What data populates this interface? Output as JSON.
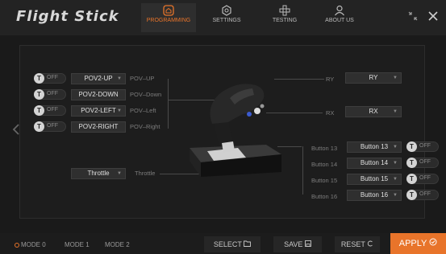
{
  "app": {
    "title": "Flight Stick"
  },
  "nav": {
    "programming": "PROGRAMMING",
    "settings": "SETTINGS",
    "testing": "TESTING",
    "about": "ABOUT US"
  },
  "colors": {
    "accent": "#e8742a",
    "background": "#1a1a1a",
    "panel": "#1d1d1d"
  },
  "left_rows": [
    {
      "toggle": "OFF",
      "button": "POV2-UP",
      "label": "POV–UP"
    },
    {
      "toggle": "OFF",
      "button": "POV2-DOWN",
      "label": "POV–Down"
    },
    {
      "toggle": "OFF",
      "button": "POV2-LEFT",
      "label": "POV–Left"
    },
    {
      "toggle": "OFF",
      "button": "POV2-RIGHT",
      "label": "POV–Right"
    }
  ],
  "throttle": {
    "button": "Throttle",
    "label": "Throttle"
  },
  "axes": [
    {
      "label": "RY",
      "value": "RY"
    },
    {
      "label": "RX",
      "value": "RX"
    }
  ],
  "right_rows": [
    {
      "label": "Button 13",
      "button": "Button 13",
      "toggle": "OFF"
    },
    {
      "label": "Button 14",
      "button": "Button 14",
      "toggle": "OFF"
    },
    {
      "label": "Button 15",
      "button": "Button 15",
      "toggle": "OFF"
    },
    {
      "label": "Button 16",
      "button": "Button 16",
      "toggle": "OFF"
    }
  ],
  "toggle_knob": "T",
  "footer": {
    "modes": [
      "MODE 0",
      "MODE 1",
      "MODE 2"
    ],
    "select": "SELECT",
    "save": "SAVE",
    "reset": "RESET",
    "apply": "APPLY"
  }
}
